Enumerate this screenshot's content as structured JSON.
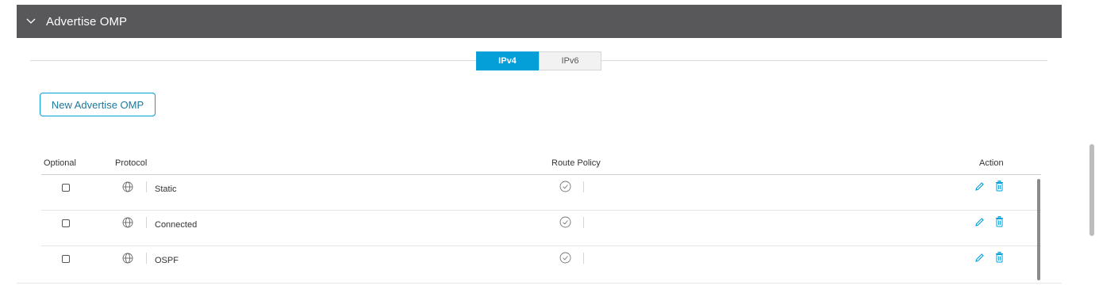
{
  "panel": {
    "title": "Advertise OMP"
  },
  "tabs": [
    {
      "label": "IPv4",
      "active": true
    },
    {
      "label": "IPv6",
      "active": false
    }
  ],
  "new_button_label": "New Advertise OMP",
  "table": {
    "headers": {
      "optional": "Optional",
      "protocol": "Protocol",
      "route_policy": "Route Policy",
      "action": "Action"
    },
    "rows": [
      {
        "protocol": "Static"
      },
      {
        "protocol": "Connected"
      },
      {
        "protocol": "OSPF"
      }
    ]
  },
  "colors": {
    "header_bg": "#58585b",
    "accent": "#049fd9"
  },
  "icons": {
    "row_protocol": "globe-icon",
    "route_policy": "check-circle-icon",
    "edit": "pencil-icon",
    "delete": "trash-icon"
  }
}
